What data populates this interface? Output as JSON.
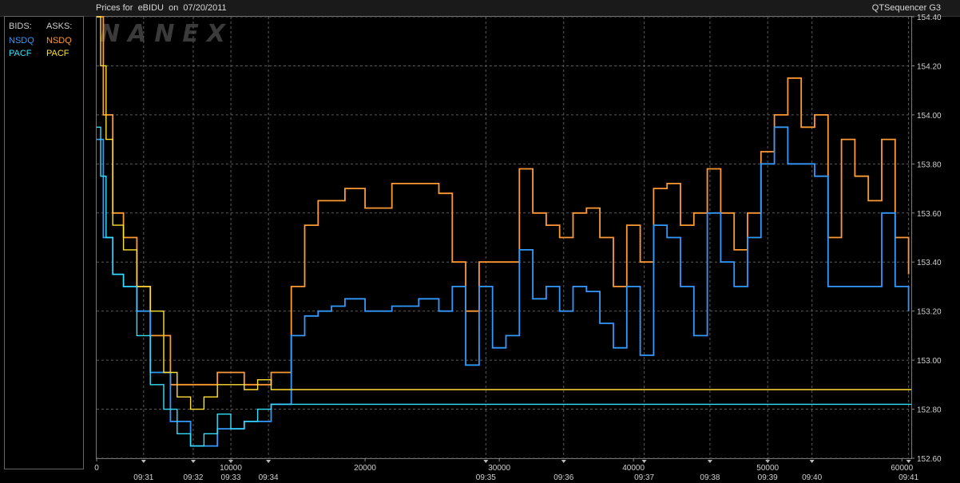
{
  "header": {
    "title": "Prices for  eBIDU  on  07/20/2011",
    "app_name": "QTSequencer G3"
  },
  "watermark": "NANEX",
  "legend": {
    "bids_label": "BIDS:",
    "asks_label": "ASKS:",
    "bids": [
      {
        "name": "NSDQ",
        "color": "#3399ff"
      },
      {
        "name": "PACF",
        "color": "#33e0ff"
      }
    ],
    "asks": [
      {
        "name": "NSDQ",
        "color": "#ff9933"
      },
      {
        "name": "PACF",
        "color": "#ffe033"
      }
    ]
  },
  "chart_data": {
    "type": "line",
    "title": "Prices for  eBIDU  on  07/20/2011",
    "x_axis": {
      "range": [
        0,
        60700
      ],
      "count_ticks": [
        0,
        10000,
        20000,
        30000,
        40000,
        50000,
        60000
      ],
      "count_tick_labels": [
        "0",
        "10000",
        "20000",
        "30000",
        "40000",
        "50000",
        "60000"
      ],
      "time_labels": [
        {
          "x": 3500,
          "label": "09:31"
        },
        {
          "x": 7200,
          "label": "09:32"
        },
        {
          "x": 10000,
          "label": "09:33"
        },
        {
          "x": 12800,
          "label": "09:34"
        },
        {
          "x": 29000,
          "label": "09:35"
        },
        {
          "x": 34800,
          "label": "09:36"
        },
        {
          "x": 40800,
          "label": "09:37"
        },
        {
          "x": 45700,
          "label": "09:38"
        },
        {
          "x": 50000,
          "label": "09:39"
        },
        {
          "x": 53300,
          "label": "09:40"
        },
        {
          "x": 60500,
          "label": "09:41"
        }
      ]
    },
    "y_axis": {
      "range": [
        152.6,
        154.4
      ],
      "ticks": [
        152.6,
        152.8,
        153.0,
        153.2,
        153.4,
        153.6,
        153.8,
        154.0,
        154.2,
        154.4
      ],
      "tick_labels": [
        "152.60",
        "152.80",
        "153.00",
        "153.20",
        "153.40",
        "153.60",
        "153.80",
        "154.00",
        "154.20",
        "154.40"
      ]
    },
    "grid": true,
    "series": [
      {
        "name": "NSDQ",
        "side": "ask",
        "color": "#ff9933",
        "x": [
          0,
          500,
          1200,
          2000,
          3000,
          4000,
          5500,
          7000,
          9000,
          11000,
          13000,
          14500,
          15500,
          16500,
          17500,
          18500,
          20000,
          22000,
          24000,
          25500,
          26500,
          27500,
          28500,
          29500,
          30500,
          31500,
          32500,
          33500,
          34500,
          35500,
          36500,
          37500,
          38500,
          39500,
          40500,
          41500,
          42500,
          43500,
          44500,
          45500,
          46500,
          47500,
          48500,
          49500,
          50500,
          51500,
          52500,
          53500,
          54500,
          55500,
          56500,
          57500,
          58500,
          59500,
          60500
        ],
        "y": [
          154.4,
          154.0,
          153.6,
          153.5,
          153.3,
          153.1,
          152.9,
          152.9,
          152.95,
          152.9,
          152.95,
          153.3,
          153.55,
          153.65,
          153.65,
          153.7,
          153.62,
          153.72,
          153.72,
          153.68,
          153.4,
          153.2,
          153.4,
          153.4,
          153.4,
          153.78,
          153.6,
          153.55,
          153.5,
          153.6,
          153.62,
          153.5,
          153.3,
          153.55,
          153.4,
          153.7,
          153.72,
          153.55,
          153.6,
          153.78,
          153.6,
          153.45,
          153.6,
          153.85,
          154.0,
          154.15,
          153.95,
          154.0,
          153.5,
          153.9,
          153.75,
          153.65,
          153.9,
          153.5,
          153.35
        ]
      },
      {
        "name": "NSDQ",
        "side": "bid",
        "color": "#3399ff",
        "x": [
          0,
          500,
          1200,
          2000,
          3000,
          4000,
          5500,
          7000,
          9000,
          11000,
          13000,
          14500,
          15500,
          16500,
          17500,
          18500,
          20000,
          22000,
          24000,
          25500,
          26500,
          27500,
          28500,
          29500,
          30500,
          31500,
          32500,
          33500,
          34500,
          35500,
          36500,
          37500,
          38500,
          39500,
          40500,
          41500,
          42500,
          43500,
          44500,
          45500,
          46500,
          47500,
          48500,
          49500,
          50500,
          51500,
          52500,
          53500,
          54500,
          55500,
          56500,
          57500,
          58500,
          59500,
          60500
        ],
        "y": [
          153.9,
          153.5,
          153.35,
          153.3,
          153.2,
          152.95,
          152.75,
          152.65,
          152.72,
          152.75,
          152.82,
          153.1,
          153.18,
          153.2,
          153.22,
          153.25,
          153.2,
          153.22,
          153.25,
          153.2,
          153.3,
          152.98,
          153.3,
          153.05,
          153.1,
          153.45,
          153.25,
          153.3,
          153.2,
          153.3,
          153.28,
          153.15,
          153.05,
          153.3,
          153.02,
          153.55,
          153.5,
          153.3,
          153.1,
          153.6,
          153.4,
          153.3,
          153.5,
          153.8,
          153.95,
          153.8,
          153.8,
          153.75,
          153.3,
          153.3,
          153.3,
          153.3,
          153.6,
          153.3,
          153.2
        ]
      },
      {
        "name": "PACF",
        "side": "ask",
        "color": "#ffe033",
        "x": [
          0,
          300,
          700,
          1200,
          2000,
          3000,
          4000,
          5000,
          6000,
          7000,
          8000,
          9000,
          10000,
          11000,
          12000,
          13000,
          60700
        ],
        "y": [
          154.4,
          154.2,
          153.9,
          153.55,
          153.45,
          153.3,
          153.2,
          152.95,
          152.85,
          152.8,
          152.85,
          152.9,
          152.9,
          152.88,
          152.92,
          152.88,
          152.88
        ]
      },
      {
        "name": "PACF",
        "side": "bid",
        "color": "#33e0ff",
        "x": [
          0,
          300,
          700,
          1200,
          2000,
          3000,
          4000,
          5000,
          6000,
          7000,
          8000,
          9000,
          10000,
          11000,
          12000,
          13000,
          60700
        ],
        "y": [
          153.95,
          153.75,
          153.5,
          153.35,
          153.3,
          153.1,
          152.9,
          152.8,
          152.7,
          152.65,
          152.7,
          152.78,
          152.72,
          152.75,
          152.8,
          152.82,
          152.82
        ]
      }
    ]
  }
}
